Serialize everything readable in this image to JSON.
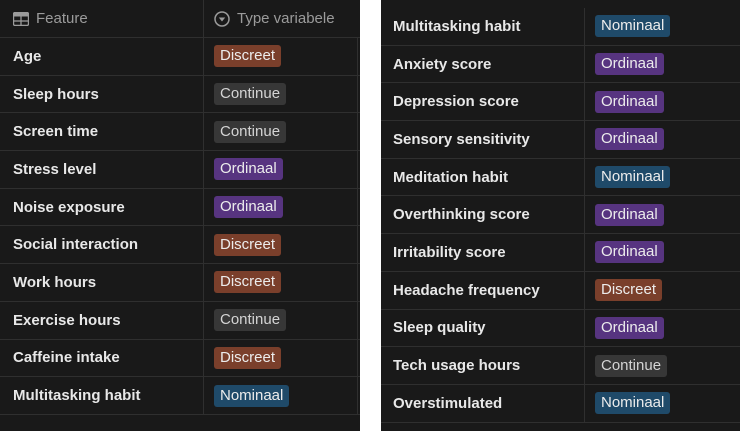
{
  "header": {
    "feature_label": "Feature",
    "type_label": "Type variabele",
    "feature_icon": "table-icon",
    "type_icon": "select-icon"
  },
  "colors": {
    "Discreet": "#7a3f2b",
    "Continue": "#373737",
    "Ordinaal": "#573480",
    "Nominaal": "#1f4a69"
  },
  "left_rows": [
    {
      "feature": "Age",
      "type": "Discreet"
    },
    {
      "feature": "Sleep hours",
      "type": "Continue"
    },
    {
      "feature": "Screen time",
      "type": "Continue"
    },
    {
      "feature": "Stress level",
      "type": "Ordinaal"
    },
    {
      "feature": "Noise exposure",
      "type": "Ordinaal"
    },
    {
      "feature": "Social interaction",
      "type": "Discreet"
    },
    {
      "feature": "Work hours",
      "type": "Discreet"
    },
    {
      "feature": "Exercise hours",
      "type": "Continue"
    },
    {
      "feature": "Caffeine intake",
      "type": "Discreet"
    },
    {
      "feature": "Multitasking habit",
      "type": "Nominaal"
    }
  ],
  "right_rows": [
    {
      "feature": "Multitasking habit",
      "type": "Nominaal"
    },
    {
      "feature": "Anxiety score",
      "type": "Ordinaal"
    },
    {
      "feature": "Depression score",
      "type": "Ordinaal"
    },
    {
      "feature": "Sensory sensitivity",
      "type": "Ordinaal"
    },
    {
      "feature": "Meditation habit",
      "type": "Nominaal"
    },
    {
      "feature": "Overthinking score",
      "type": "Ordinaal"
    },
    {
      "feature": "Irritability score",
      "type": "Ordinaal"
    },
    {
      "feature": "Headache frequency",
      "type": "Discreet"
    },
    {
      "feature": "Sleep quality",
      "type": "Ordinaal"
    },
    {
      "feature": "Tech usage hours",
      "type": "Continue"
    },
    {
      "feature": "Overstimulated",
      "type": "Nominaal"
    }
  ]
}
